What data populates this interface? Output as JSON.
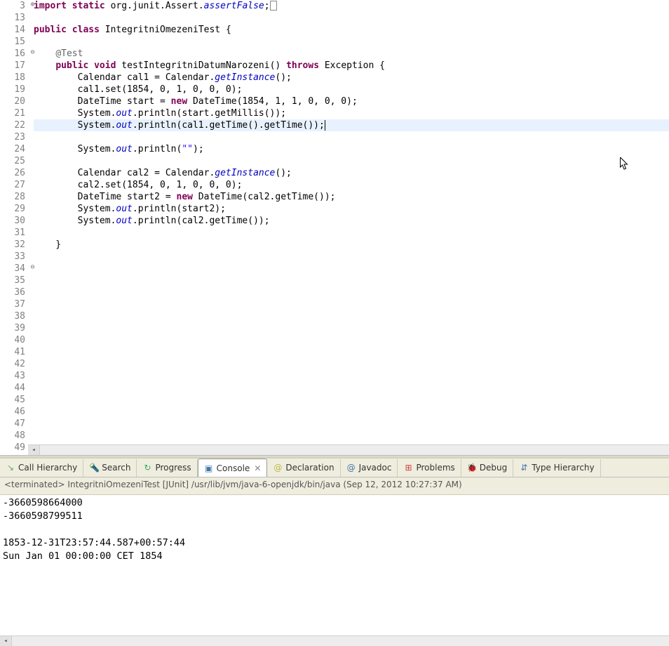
{
  "editor": {
    "line_numbers": [
      3,
      13,
      14,
      15,
      16,
      17,
      18,
      19,
      20,
      21,
      22,
      23,
      24,
      25,
      26,
      27,
      28,
      29,
      30,
      31,
      32,
      33,
      34,
      35,
      36,
      37,
      38,
      39,
      40,
      41,
      42,
      43,
      44,
      45,
      46,
      47,
      48,
      49
    ],
    "fold_plus_lines": [
      3
    ],
    "fold_minus_lines": [
      16,
      34
    ],
    "current_line": 22,
    "tokens": {
      "l3": {
        "t1": "import",
        "t2": " ",
        "t3": "static",
        "t4": " org.junit.Assert.",
        "t5": "assertFalse",
        "t6": ";"
      },
      "l14": {
        "t1": "public",
        "t2": " ",
        "t3": "class",
        "t4": " IntegritniOmezeniTest {"
      },
      "l16": {
        "t1": "    ",
        "t2": "@Test"
      },
      "l17": {
        "t1": "    ",
        "t2": "public",
        "t3": " ",
        "t4": "void",
        "t5": " testIntegritniDatumNarozeni() ",
        "t6": "throws",
        "t7": " Exception {"
      },
      "l18": {
        "t1": "        Calendar cal1 = Calendar.",
        "t2": "getInstance",
        "t3": "();"
      },
      "l19": {
        "t1": "        cal1.set(1854, 0, 1, 0, 0, 0);"
      },
      "l20": {
        "t1": "        DateTime start = ",
        "t2": "new",
        "t3": " DateTime(1854, 1, 1, 0, 0, 0);"
      },
      "l21": {
        "t1": "        System.",
        "t2": "out",
        "t3": ".println(start.getMillis());"
      },
      "l22": {
        "t1": "        System.",
        "t2": "out",
        "t3": ".println(cal1.getTime().getTime());"
      },
      "l24": {
        "t1": "        System.",
        "t2": "out",
        "t3": ".println(",
        "t4": "\"\"",
        "t5": ");"
      },
      "l26": {
        "t1": "        Calendar cal2 = Calendar.",
        "t2": "getInstance",
        "t3": "();"
      },
      "l27": {
        "t1": "        cal2.set(1854, 0, 1, 0, 0, 0);"
      },
      "l28": {
        "t1": "        DateTime start2 = ",
        "t2": "new",
        "t3": " DateTime(cal2.getTime());"
      },
      "l29": {
        "t1": "        System.",
        "t2": "out",
        "t3": ".println(start2);"
      },
      "l30": {
        "t1": "        System.",
        "t2": "out",
        "t3": ".println(cal2.getTime());"
      },
      "l32": {
        "t1": "    }"
      }
    }
  },
  "tabs": [
    {
      "icon": "↘",
      "color": "#6a6",
      "label": "Call Hierarchy"
    },
    {
      "icon": "🔦",
      "color": "#d90",
      "label": "Search"
    },
    {
      "icon": "↻",
      "color": "#3a6",
      "label": "Progress"
    },
    {
      "icon": "▣",
      "color": "#47a",
      "label": "Console",
      "active": true,
      "closable": true
    },
    {
      "icon": "@",
      "color": "#bb4",
      "label": "Declaration"
    },
    {
      "icon": "@",
      "color": "#47a",
      "label": "Javadoc"
    },
    {
      "icon": "⊞",
      "color": "#c44",
      "label": "Problems"
    },
    {
      "icon": "🐞",
      "color": "#4a4",
      "label": "Debug"
    },
    {
      "icon": "⇵",
      "color": "#47a",
      "label": "Type Hierarchy"
    }
  ],
  "status_line": "<terminated> IntegritniOmezeniTest [JUnit] /usr/lib/jvm/java-6-openjdk/bin/java (Sep 12, 2012 10:27:37 AM)",
  "console_output": "-3660598664000\n-3660598799511\n\n1853-12-31T23:57:44.587+00:57:44\nSun Jan 01 00:00:00 CET 1854",
  "scroll_arrow": "◂"
}
